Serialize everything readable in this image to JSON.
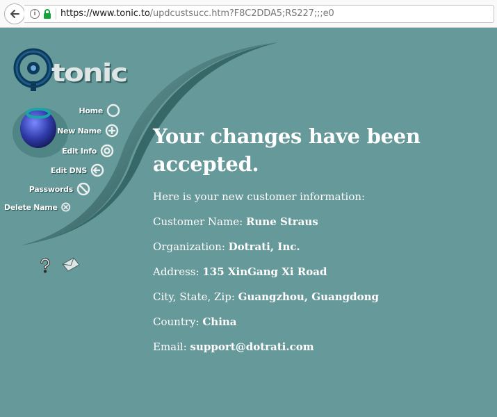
{
  "browser": {
    "url_host": "https://www.tonic.to",
    "url_path": "/updcustsucc.htm?F8C2DDA5;RS227;;;e0",
    "icons": {
      "back": "back-arrow-icon",
      "info": "info-icon",
      "lock": "lock-icon"
    },
    "info_glyph": "i"
  },
  "brand": {
    "logo_text": "tonic"
  },
  "nav": {
    "items": [
      {
        "label": "Home",
        "icon": "circle-icon"
      },
      {
        "label": "New Name",
        "icon": "plus-icon"
      },
      {
        "label": "Edit Info",
        "icon": "target-icon"
      },
      {
        "label": "Edit DNS",
        "icon": "arrow-left-icon"
      },
      {
        "label": "Passwords",
        "icon": "prohibited-icon"
      },
      {
        "label": "Delete Name",
        "icon": "x-icon"
      }
    ],
    "utility": {
      "help_icon": "question-mark-icon",
      "mail_icon": "envelope-icon"
    }
  },
  "main": {
    "headline": "Your changes have been accepted.",
    "intro": "Here is your new customer information:",
    "fields": [
      {
        "label": "Customer Name:",
        "value": "Rune Straus"
      },
      {
        "label": "Organization:",
        "value": "Dotrati, Inc."
      },
      {
        "label": "Address:",
        "value": "135 XinGang Xi Road"
      },
      {
        "label": "City, State, Zip:",
        "value": "Guangzhou, Guangdong"
      },
      {
        "label": "Country:",
        "value": "China"
      },
      {
        "label": "Email:",
        "value": "support@dotrati.com"
      }
    ]
  },
  "colors": {
    "page_bg": "#669999",
    "swoosh": "#2f5f5f",
    "ring": "#0c3a5a"
  }
}
